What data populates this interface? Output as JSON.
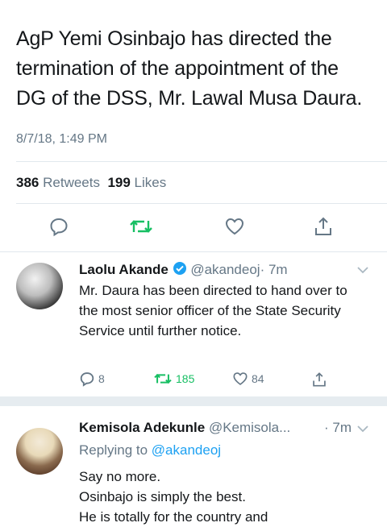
{
  "main_tweet": {
    "text": "AgP Yemi Osinbajo has directed the termination of the appointment of the DG of the DSS, Mr. Lawal Musa Daura.",
    "timestamp": "8/7/18, 1:49 PM",
    "retweets_count": "386",
    "retweets_label": "Retweets",
    "likes_count": "199",
    "likes_label": "Likes",
    "actions": [
      "reply-icon",
      "retweet-icon",
      "like-icon",
      "share-icon"
    ]
  },
  "reply1": {
    "name": "Laolu Akande",
    "handle": "@akandeoj",
    "time": "· 7m",
    "text": "Mr. Daura has been directed to hand over to the most senior officer of the State Security Service until further notice.",
    "reply_count": "8",
    "retweet_count": "185",
    "like_count": "84"
  },
  "reply2": {
    "name": "Kemisola Adekunle",
    "handle": "@Kemisola...",
    "time": "· 7m",
    "replying_prefix": "Replying to",
    "replying_to": "@akandeoj",
    "line1": "Say no more.",
    "line2": "Osinbajo is simply the best.",
    "line3": "He is totally for the country and"
  },
  "colors": {
    "accent_blue": "#1da1f2",
    "retweet_green": "#17bf63",
    "muted_gray": "#657786",
    "band_gray": "#e6ecf0"
  }
}
